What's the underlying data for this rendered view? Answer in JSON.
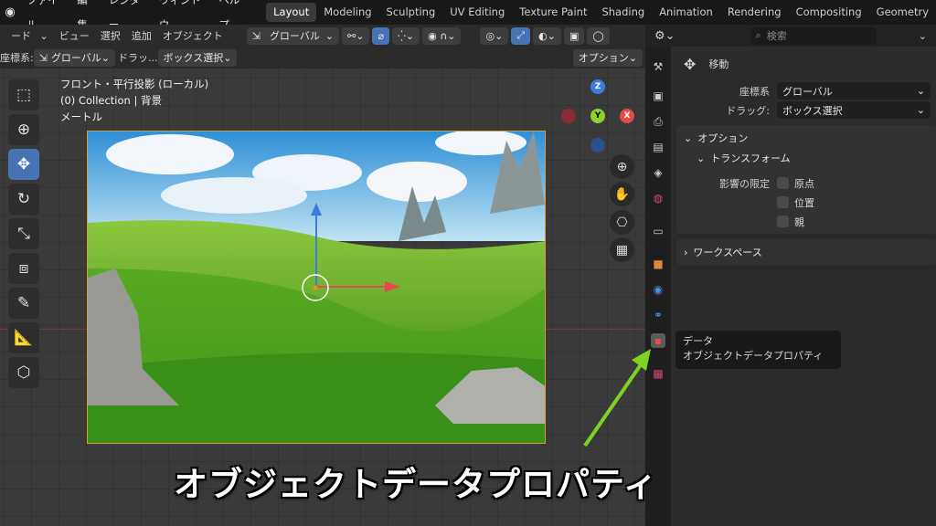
{
  "topbar": {
    "logo": "blender-logo",
    "menus": [
      "ファイル",
      "編集",
      "レンダー",
      "ウィンドウ",
      "ヘルプ"
    ],
    "workspaces": [
      "Layout",
      "Modeling",
      "Sculpting",
      "UV Editing",
      "Texture Paint",
      "Shading",
      "Animation",
      "Rendering",
      "Compositing",
      "Geometry"
    ],
    "active_workspace": "Layout"
  },
  "header": {
    "mode": "ード",
    "view": "ビュー",
    "select": "選択",
    "add": "追加",
    "object": "オブジェクト",
    "transform_orientation": "グローバル"
  },
  "subheader": {
    "coord_label": "座標系:",
    "coord_value": "グローバル",
    "drag_label": "ドラッ...",
    "drag_value": "ボックス選択",
    "options": "オプション"
  },
  "viewport": {
    "view_name": "フロント・平行投影 (ローカル)",
    "collection": "(0) Collection | 背景",
    "units": "メートル"
  },
  "navigation": {
    "z": "Z",
    "y": "Y",
    "x": "X"
  },
  "right_panel": {
    "search_placeholder": "検索",
    "tool_name": "移動",
    "coord_label": "座標系",
    "coord_value": "グローバル",
    "drag_label": "ドラッグ:",
    "drag_value": "ボックス選択",
    "options_title": "オプション",
    "transform_title": "トランスフォーム",
    "affect_label": "影響の限定",
    "affect_items": [
      "原点",
      "位置",
      "親"
    ],
    "workspace_title": "ワークスペース"
  },
  "tooltip": {
    "title": "データ",
    "subtitle": "オブジェクトデータプロパティ"
  },
  "caption": "オブジェクトデータプロパティ",
  "colors": {
    "accent": "#4772b3",
    "x_axis": "#e64a4a",
    "y_axis": "#8bd12a",
    "z_axis": "#3e7be0",
    "arrow": "#7ed321"
  }
}
